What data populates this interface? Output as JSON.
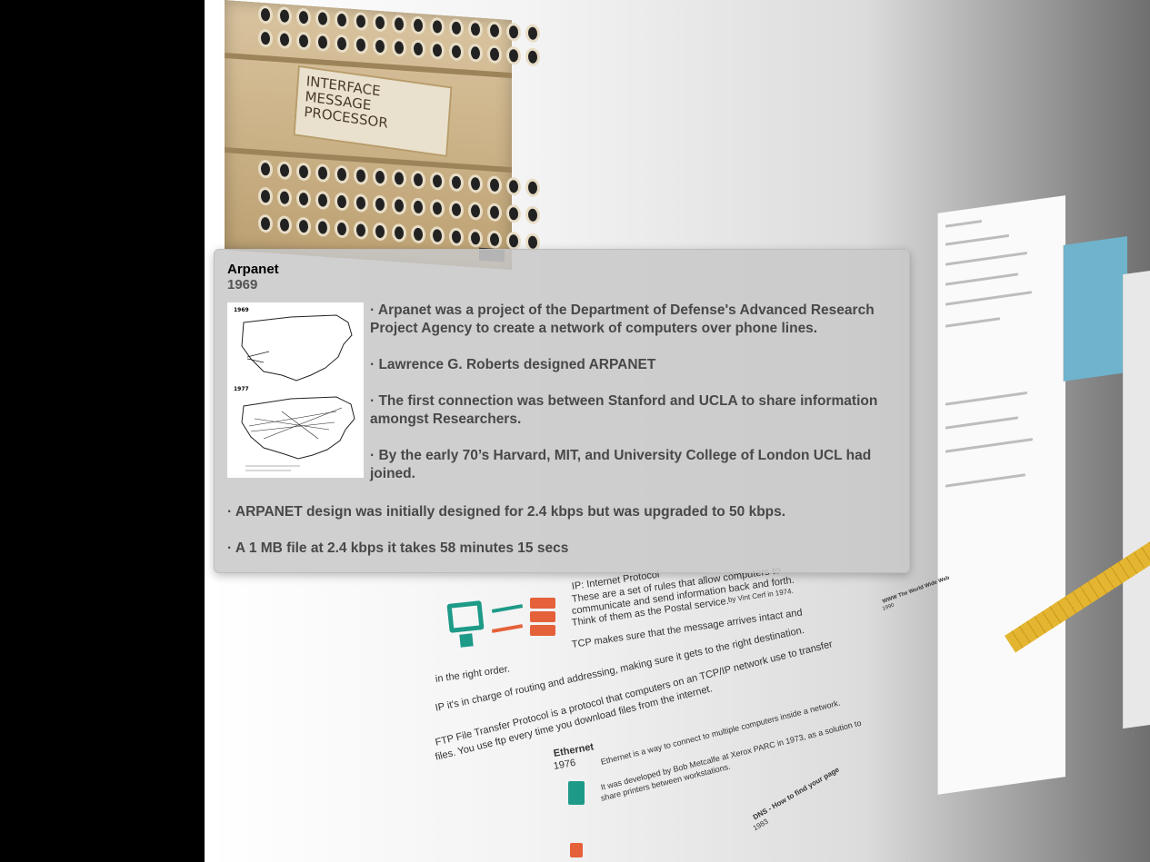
{
  "popup": {
    "title": "Arpanet",
    "year": "1969",
    "map_labels": [
      "1969",
      "1977"
    ],
    "bullets": [
      "· Arpanet was a project of the Department of Defense's Advanced Research Project Agency to create a network of computers over phone lines.",
      "· Lawrence G. Roberts designed ARPANET",
      "· The first connection was between Stanford and UCLA to share information amongst Researchers.",
      "· By the early 70’s Harvard, MIT, and University College of London UCL had joined."
    ],
    "bullets_wide": [
      "· ARPANET design was initially designed for 2.4 kbps but was upgraded to 50 kbps.",
      "· A 1 MB file at 2.4 kbps it takes 58 minutes 15 secs"
    ]
  },
  "machine": {
    "plate_text": "INTERFACE MESSAGE PROCESSOR"
  },
  "timeline": {
    "tcp_lines": [
      "IP: Internet Protocol",
      "These are a set of rules that allow computers to",
      "communicate and send information back and forth.",
      "Think of them as the Postal service.",
      "TCP makes sure that the message arrives intact and"
    ],
    "in_right_order": "in the right order.",
    "ip_line": "IP it's in charge of routing and addressing, making sure it gets to the right destination.",
    "ftp_line1": "FTP File Transfer Protocol is a protocol that computers on an TCP/IP network use to transfer",
    "ftp_line2": "files. You use ftp every time you download files from the internet.",
    "ethernet_title": "Ethernet",
    "ethernet_year": "1976",
    "ethernet_line1": "Ethernet is a way to connect to multiple computers inside a network.",
    "ethernet_line2": "It was developed by Bob Metcalfe at Xerox PARC in 1973, as a solution to",
    "ethernet_line3": "share printers between workstations.",
    "vint_cerf": "by Vint Cerf in 1974.",
    "dns_title": "DNS - How to find your page",
    "dns_year": "1983",
    "www_title": "WWW The World Wide Web",
    "www_year": "1990"
  },
  "colors": {
    "teal": "#1e9a88",
    "orange": "#e5613a",
    "ruler": "#e4b530"
  }
}
